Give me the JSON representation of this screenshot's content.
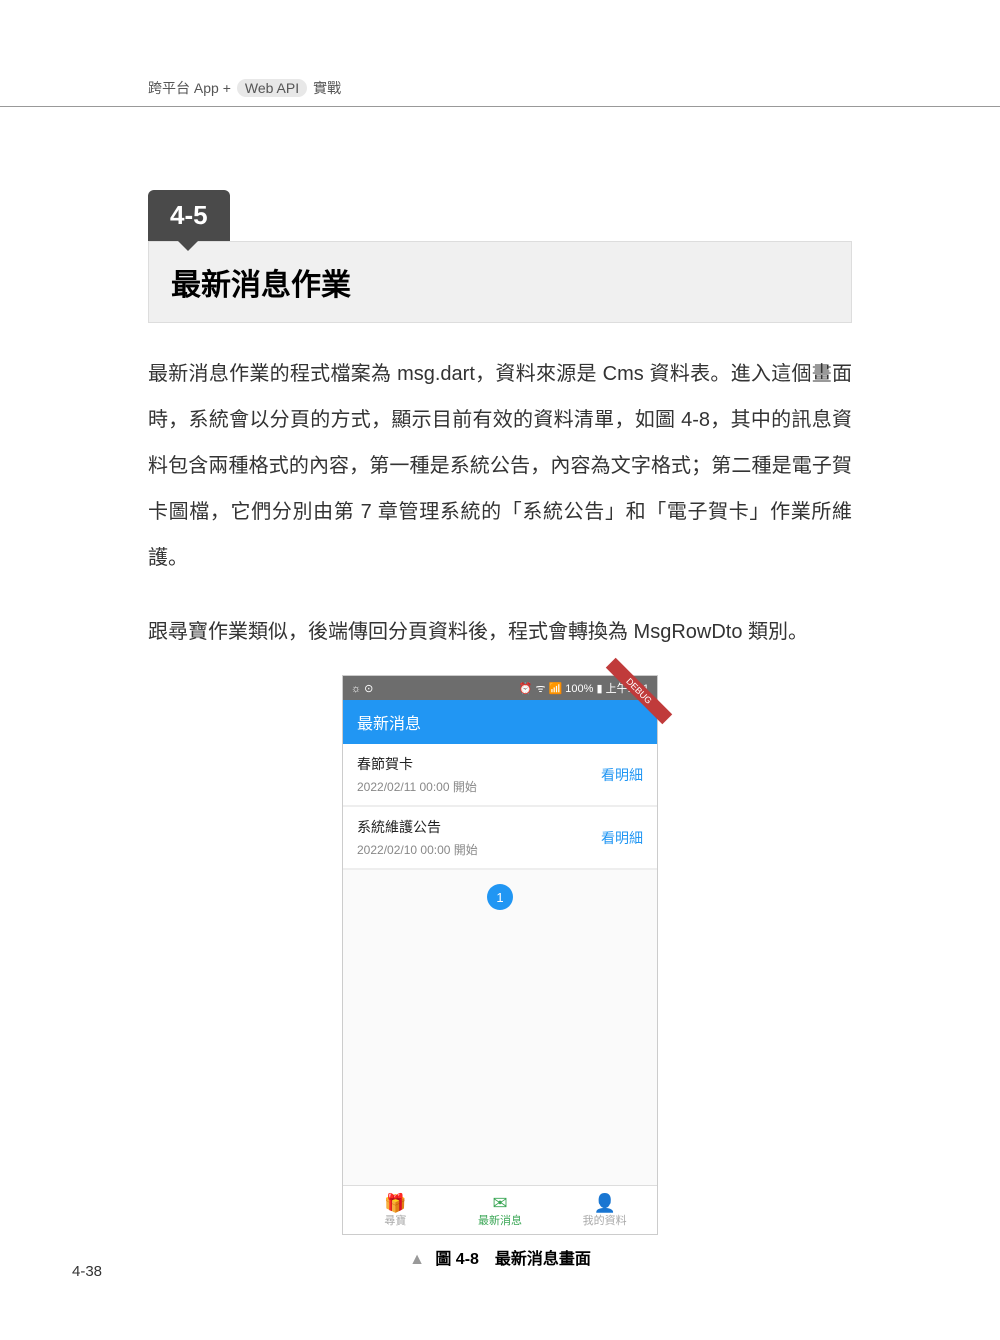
{
  "header": {
    "left": "跨平台 App +",
    "pill": "Web API",
    "right": "實戰"
  },
  "section": {
    "number": "4-5",
    "title": "最新消息作業"
  },
  "paragraphs": {
    "p1": "最新消息作業的程式檔案為 msg.dart，資料來源是 Cms 資料表。進入這個畫面時，系統會以分頁的方式，顯示目前有效的資料清單，如圖 4-8，其中的訊息資料包含兩種格式的內容，第一種是系統公告，內容為文字格式；第二種是電子賀卡圖檔，它們分別由第 7 章管理系統的「系統公告」和「電子賀卡」作業所維護。",
    "p2": "跟尋寶作業類似，後端傳回分頁資料後，程式會轉換為 MsgRowDto 類別。"
  },
  "phone": {
    "status_left_icons": "☼ ⊙",
    "status_right": "⏰ ᯤ 📶 100% ▮ 上午1:01",
    "debug": "DEBUG",
    "appbar_title": "最新消息",
    "items": [
      {
        "title": "春節賀卡",
        "sub": "2022/02/11 00:00 開始",
        "action": "看明細"
      },
      {
        "title": "系統維護公告",
        "sub": "2022/02/10 00:00 開始",
        "action": "看明細"
      }
    ],
    "page_indicator": "1",
    "tabs": [
      {
        "icon": "🎁",
        "label": "尋寶"
      },
      {
        "icon": "✉",
        "label": "最新消息"
      },
      {
        "icon": "👤",
        "label": "我的資料"
      }
    ]
  },
  "figure": {
    "caption": "圖 4-8　最新消息畫面"
  },
  "pagenum": "4-38"
}
